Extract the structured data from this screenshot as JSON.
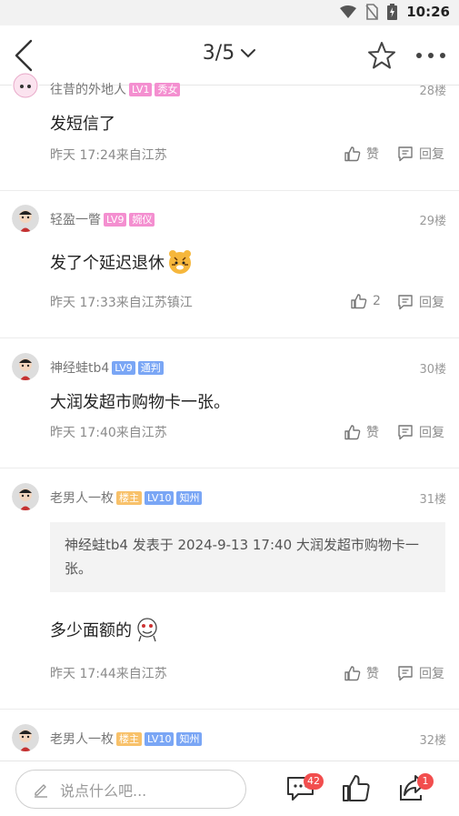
{
  "status": {
    "time": "10:26"
  },
  "nav": {
    "page_indicator": "3/5"
  },
  "posts": [
    {
      "user": "往昔的外地人",
      "badges": [
        "LV1",
        "秀女"
      ],
      "floor": "28楼",
      "content": "发短信了",
      "meta": "昨天 17:24来自江苏",
      "like": "赞",
      "reply": "回复"
    },
    {
      "user": "轻盈一瞥",
      "badges": [
        "LV9",
        "婉仪"
      ],
      "floor": "29楼",
      "content": "发了个延迟退休",
      "meta": "昨天 17:33来自江苏镇江",
      "like": "2",
      "reply": "回复"
    },
    {
      "user": "神经蛙tb4",
      "badges": [
        "LV9",
        "通判"
      ],
      "floor": "30楼",
      "content": "大润发超市购物卡一张。",
      "meta": "昨天 17:40来自江苏",
      "like": "赞",
      "reply": "回复"
    },
    {
      "user": "老男人一枚",
      "badges": [
        "楼主",
        "LV10",
        "知州"
      ],
      "floor": "31楼",
      "quote": "神经蛙tb4 发表于 2024-9-13 17:40 大润发超市购物卡一张。",
      "content": "多少面额的",
      "meta": "昨天 17:44来自江苏",
      "like": "赞",
      "reply": "回复"
    },
    {
      "user": "老男人一枚",
      "badges": [
        "楼主",
        "LV10",
        "知州"
      ],
      "floor": "32楼"
    }
  ],
  "bottom": {
    "placeholder": "说点什么吧...",
    "comment_count": "42",
    "share_count": "1"
  },
  "colors": {
    "badge_pink": "#f48fd0",
    "badge_blue": "#7aa6f5",
    "badge_orange": "#f8c16a",
    "notify_red": "#f24e4e"
  }
}
